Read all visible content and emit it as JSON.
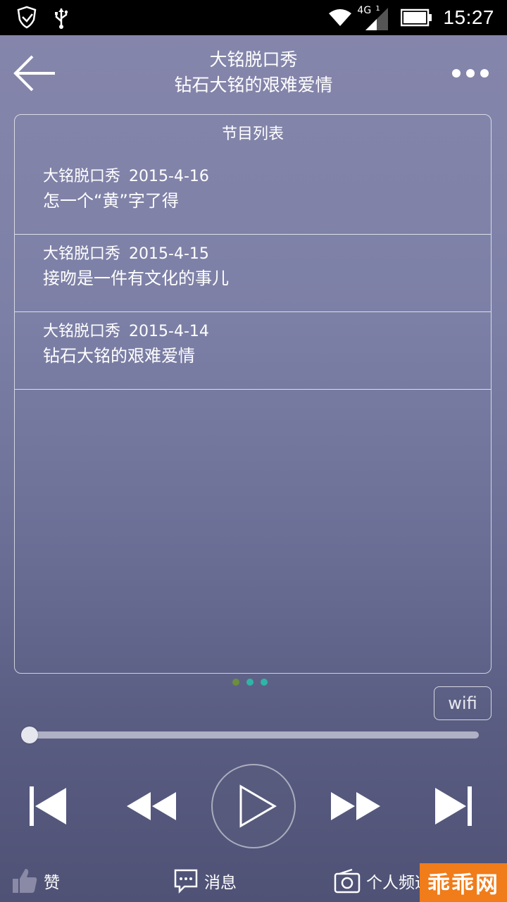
{
  "status_bar": {
    "network": "4G",
    "signal_sub": "1",
    "time": "15:27"
  },
  "header": {
    "title": "大铭脱口秀",
    "subtitle": "钻石大铭的艰难爱情"
  },
  "playlist": {
    "heading": "节目列表",
    "items": [
      {
        "show": "大铭脱口秀",
        "date": "2015-4-16",
        "name": "怎一个“黄”字了得"
      },
      {
        "show": "大铭脱口秀",
        "date": "2015-4-15",
        "name": "接吻是一件有文化的事儿"
      },
      {
        "show": "大铭脱口秀",
        "date": "2015-4-14",
        "name": "钻石大铭的艰难爱情"
      }
    ]
  },
  "pager": {
    "pages": 3,
    "active": 0,
    "colors": [
      "#6b8f3d",
      "#2fb5a6",
      "#2fb5a6"
    ]
  },
  "wifi_label": "wifi",
  "playback": {
    "progress": 0.0
  },
  "bottom_bar": {
    "like_label": "赞",
    "message_label": "消息",
    "channel_label": "个人频道"
  },
  "watermark": "乖乖网",
  "colors": {
    "accent": "#f07c1a"
  }
}
